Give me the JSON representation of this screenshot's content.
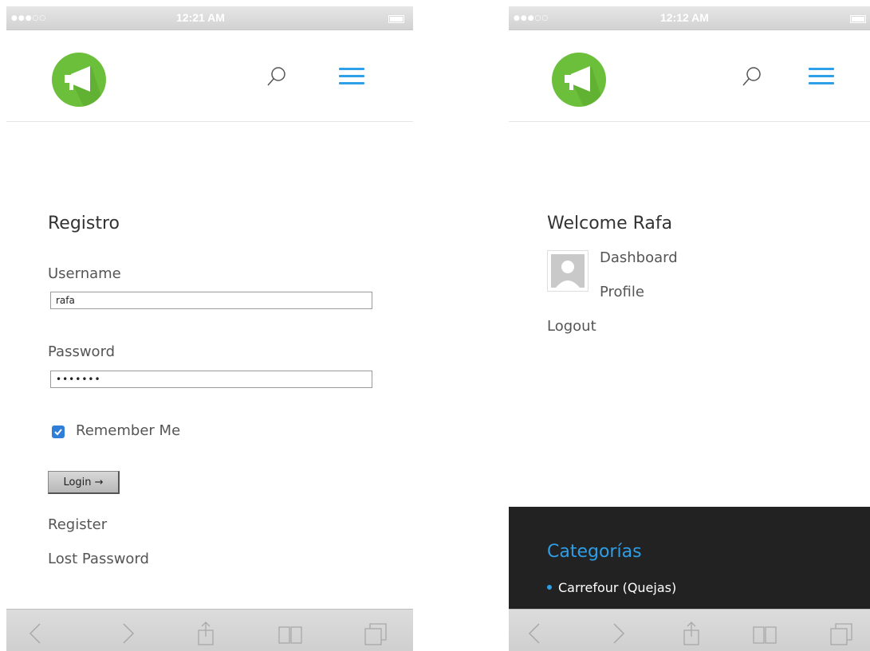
{
  "left_screen": {
    "status_bar": {
      "time": "12:21 AM"
    },
    "form": {
      "title": "Registro",
      "username_label": "Username",
      "username_value": "rafa",
      "password_label": "Password",
      "password_value": "•••••••",
      "remember_label": "Remember Me",
      "remember_checked": true,
      "login_button": "Login →",
      "register_link": "Register",
      "lost_password_link": "Lost Password"
    }
  },
  "right_screen": {
    "status_bar": {
      "time": "12:12 AM"
    },
    "welcome": {
      "title": "Welcome Rafa",
      "dashboard_link": "Dashboard",
      "profile_link": "Profile",
      "logout_link": "Logout"
    },
    "footer": {
      "title": "Categorías",
      "items": [
        "Carrefour (Quejas)"
      ]
    }
  },
  "colors": {
    "logo_green": "#6cbf3a",
    "accent_blue": "#2ea0e8",
    "footer_bg": "#222222"
  },
  "icons": [
    "megaphone-logo-icon",
    "search-icon",
    "hamburger-menu-icon",
    "back-icon",
    "forward-icon",
    "share-icon",
    "bookmarks-icon",
    "tabs-icon",
    "avatar-placeholder-icon",
    "checkbox-checked-icon"
  ]
}
